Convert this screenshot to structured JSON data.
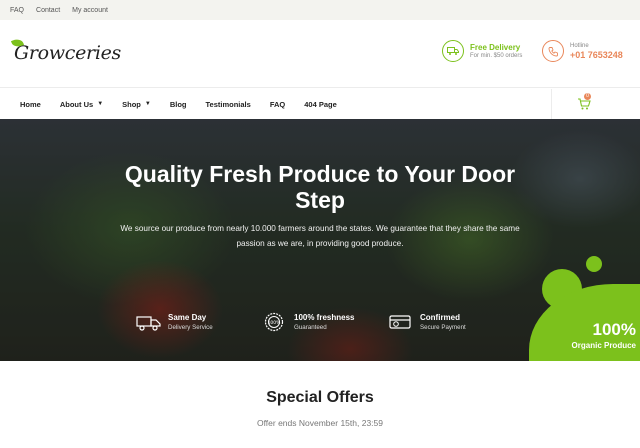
{
  "topbar": {
    "links": [
      "FAQ",
      "Contact",
      "My account"
    ]
  },
  "brand": {
    "logo_text": "Growceries"
  },
  "delivery": {
    "title": "Free Delivery",
    "subtitle": "For min. $50 orders"
  },
  "hotline": {
    "label": "Hotline",
    "number": "+01 7653248"
  },
  "nav": {
    "items": [
      "Home",
      "About Us",
      "Shop",
      "Blog",
      "Testimonials",
      "FAQ",
      "404 Page"
    ],
    "cart_count": "0"
  },
  "hero": {
    "title": "Quality Fresh Produce to Your Door Step",
    "description": "We source our produce from nearly 10.000 farmers around the states. We guarantee that they share the same passion as we are, in providing good produce.",
    "features": [
      {
        "title": "Same Day",
        "subtitle": "Delivery Service",
        "icon": "truck-icon"
      },
      {
        "title": "100% freshness",
        "subtitle": "Guaranteed",
        "icon": "badge-icon"
      },
      {
        "title": "Confirmed",
        "subtitle": "Secure Payment",
        "icon": "card-icon"
      }
    ],
    "organic_percent": "100%",
    "organic_label": "Organic Produce"
  },
  "offers": {
    "title": "Special Offers",
    "subtitle": "Offer ends November 15th, 23:59"
  },
  "colors": {
    "accent": "#7cc11c",
    "secondary": "#e9875a"
  }
}
